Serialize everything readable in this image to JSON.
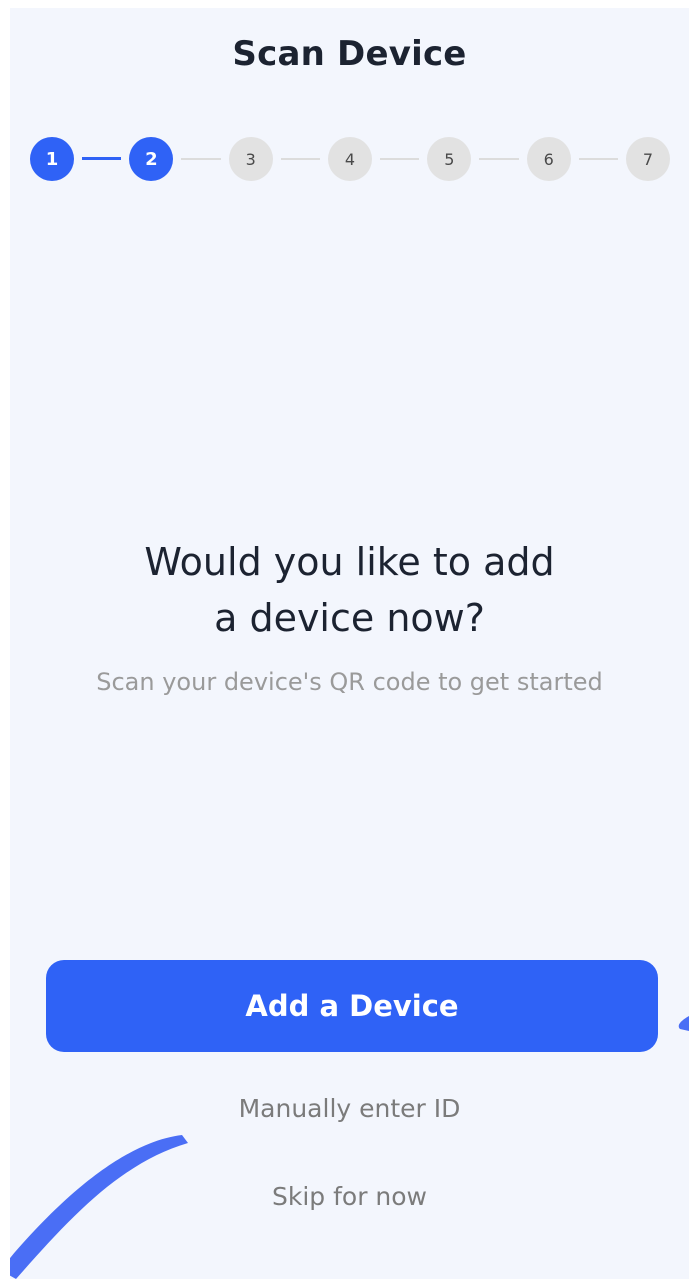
{
  "header": {
    "title": "Scan Device"
  },
  "stepper": {
    "current_step": 2,
    "total_steps": 7,
    "steps": [
      "1",
      "2",
      "3",
      "4",
      "5",
      "6",
      "7"
    ],
    "active_color": "#2f62f6",
    "inactive_color": "#e2e2e2"
  },
  "main": {
    "question_line1": "Would you like to add",
    "question_line2": "a device now?",
    "subtitle": "Scan your device's QR code to get started"
  },
  "actions": {
    "primary_label": "Add a Device",
    "manual_label": "Manually enter ID",
    "skip_label": "Skip for now"
  },
  "colors": {
    "accent": "#2f62f6",
    "background": "#f3f6fd",
    "decoration": "#4a6ef5"
  }
}
